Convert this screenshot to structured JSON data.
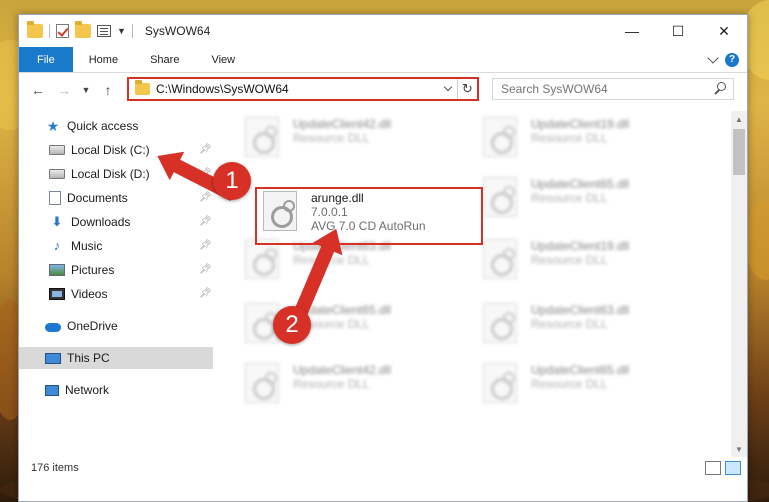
{
  "window": {
    "title": "SysWOW64",
    "controls": {
      "minimize": "—",
      "maximize": "☐",
      "close": "✕"
    }
  },
  "ribbon": {
    "file": "File",
    "home": "Home",
    "share": "Share",
    "view": "View"
  },
  "address": {
    "path": "C:\\Windows\\SysWOW64",
    "search_placeholder": "Search SysWOW64"
  },
  "sidebar": {
    "items": [
      {
        "label": "Quick access",
        "icon": "star-icon"
      },
      {
        "label": "Local Disk (C:)",
        "icon": "disk-icon",
        "pinned": true
      },
      {
        "label": "Local Disk (D:)",
        "icon": "disk-icon",
        "pinned": true
      },
      {
        "label": "Documents",
        "icon": "document-icon",
        "pinned": true
      },
      {
        "label": "Downloads",
        "icon": "download-icon",
        "pinned": true
      },
      {
        "label": "Music",
        "icon": "music-icon",
        "pinned": true
      },
      {
        "label": "Pictures",
        "icon": "pictures-icon",
        "pinned": true
      },
      {
        "label": "Videos",
        "icon": "videos-icon",
        "pinned": true
      },
      {
        "label": "OneDrive",
        "icon": "cloud-icon"
      },
      {
        "label": "This PC",
        "icon": "computer-icon",
        "selected": true
      },
      {
        "label": "Network",
        "icon": "network-icon"
      }
    ]
  },
  "files": {
    "highlighted": {
      "name": "arunge.dll",
      "version": "7.0.0.1",
      "description": "AVG 7.0 CD AutoRun"
    },
    "background": [
      {
        "name": "UpdateClient42.dll",
        "type": "Resource DLL"
      },
      {
        "name": "UpdateClient19.dll",
        "type": "Resource DLL"
      },
      {
        "name": "UpdateClient65.dll",
        "type": "Resource DLL"
      },
      {
        "name": "UpdateClient63.dll",
        "type": "Resource DLL"
      },
      {
        "name": "UpdateClient19.dll",
        "type": "Resource DLL"
      },
      {
        "name": "UpdateClient65.dll",
        "type": "Resource DLL"
      },
      {
        "name": "UpdateClient63.dll",
        "type": "Resource DLL"
      },
      {
        "name": "UpdateClient42.dll",
        "type": "Resource DLL"
      },
      {
        "name": "UpdateClient65.dll",
        "type": "Resource DLL"
      }
    ]
  },
  "status": {
    "count": "176 items"
  },
  "annotations": {
    "step1": "1",
    "step2": "2"
  },
  "colors": {
    "accent": "#1979ca",
    "annotation": "#d73027"
  }
}
